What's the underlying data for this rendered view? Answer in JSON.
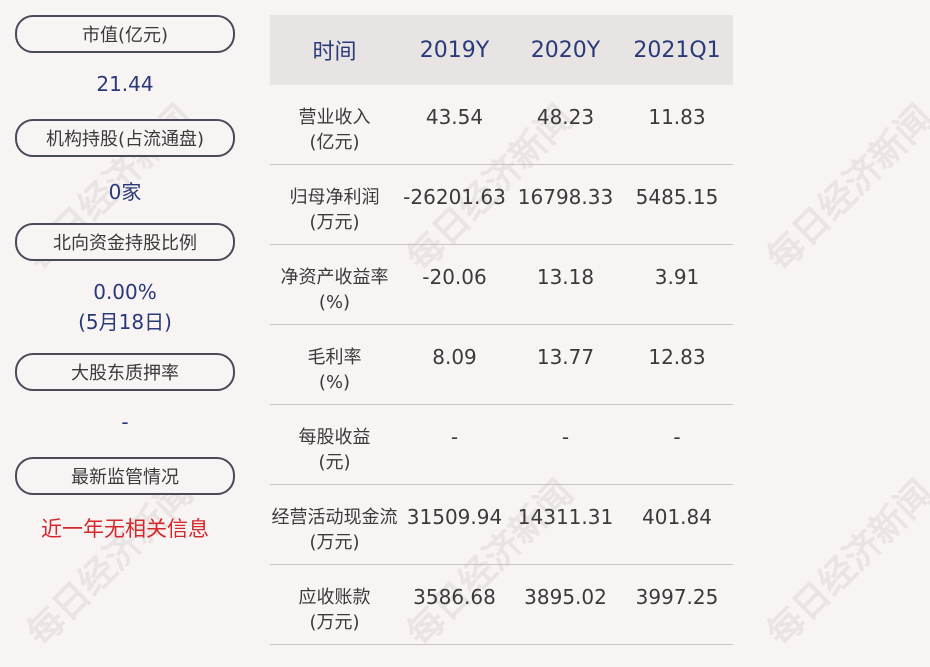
{
  "left": {
    "items": [
      {
        "label": "市值(亿元)",
        "value": "21.44",
        "value2": ""
      },
      {
        "label": "机构持股(占流通盘)",
        "value": "0家",
        "value2": ""
      },
      {
        "label": "北向资金持股比例",
        "value": "0.00%",
        "value2": "(5月18日)"
      },
      {
        "label": "大股东质押率",
        "value": "-",
        "value2": ""
      },
      {
        "label": "最新监管情况",
        "value": "近一年无相关信息",
        "value2": ""
      }
    ]
  },
  "table": {
    "headers": [
      "时间",
      "2019Y",
      "2020Y",
      "2021Q1"
    ],
    "rows": [
      {
        "label1": "营业收入",
        "label2": "(亿元)",
        "v": [
          "43.54",
          "48.23",
          "11.83"
        ]
      },
      {
        "label1": "归母净利润",
        "label2": "(万元)",
        "v": [
          "-26201.63",
          "16798.33",
          "5485.15"
        ]
      },
      {
        "label1": "净资产收益率",
        "label2": "(%)",
        "v": [
          "-20.06",
          "13.18",
          "3.91"
        ]
      },
      {
        "label1": "毛利率",
        "label2": "(%)",
        "v": [
          "8.09",
          "13.77",
          "12.83"
        ]
      },
      {
        "label1": "每股收益",
        "label2": "(元)",
        "v": [
          "-",
          "-",
          "-"
        ]
      },
      {
        "label1": "经营活动现金流",
        "label2": "(万元)",
        "v": [
          "31509.94",
          "14311.31",
          "401.84"
        ]
      },
      {
        "label1": "应收账款",
        "label2": "(万元)",
        "v": [
          "3586.68",
          "3895.02",
          "3997.25"
        ]
      }
    ]
  },
  "watermark": "每日经济新闻",
  "colors": {
    "accent": "#2a3a78",
    "alert": "#d3282c",
    "background": "#f8f4f4",
    "header_bg": "#e8e4e4"
  }
}
